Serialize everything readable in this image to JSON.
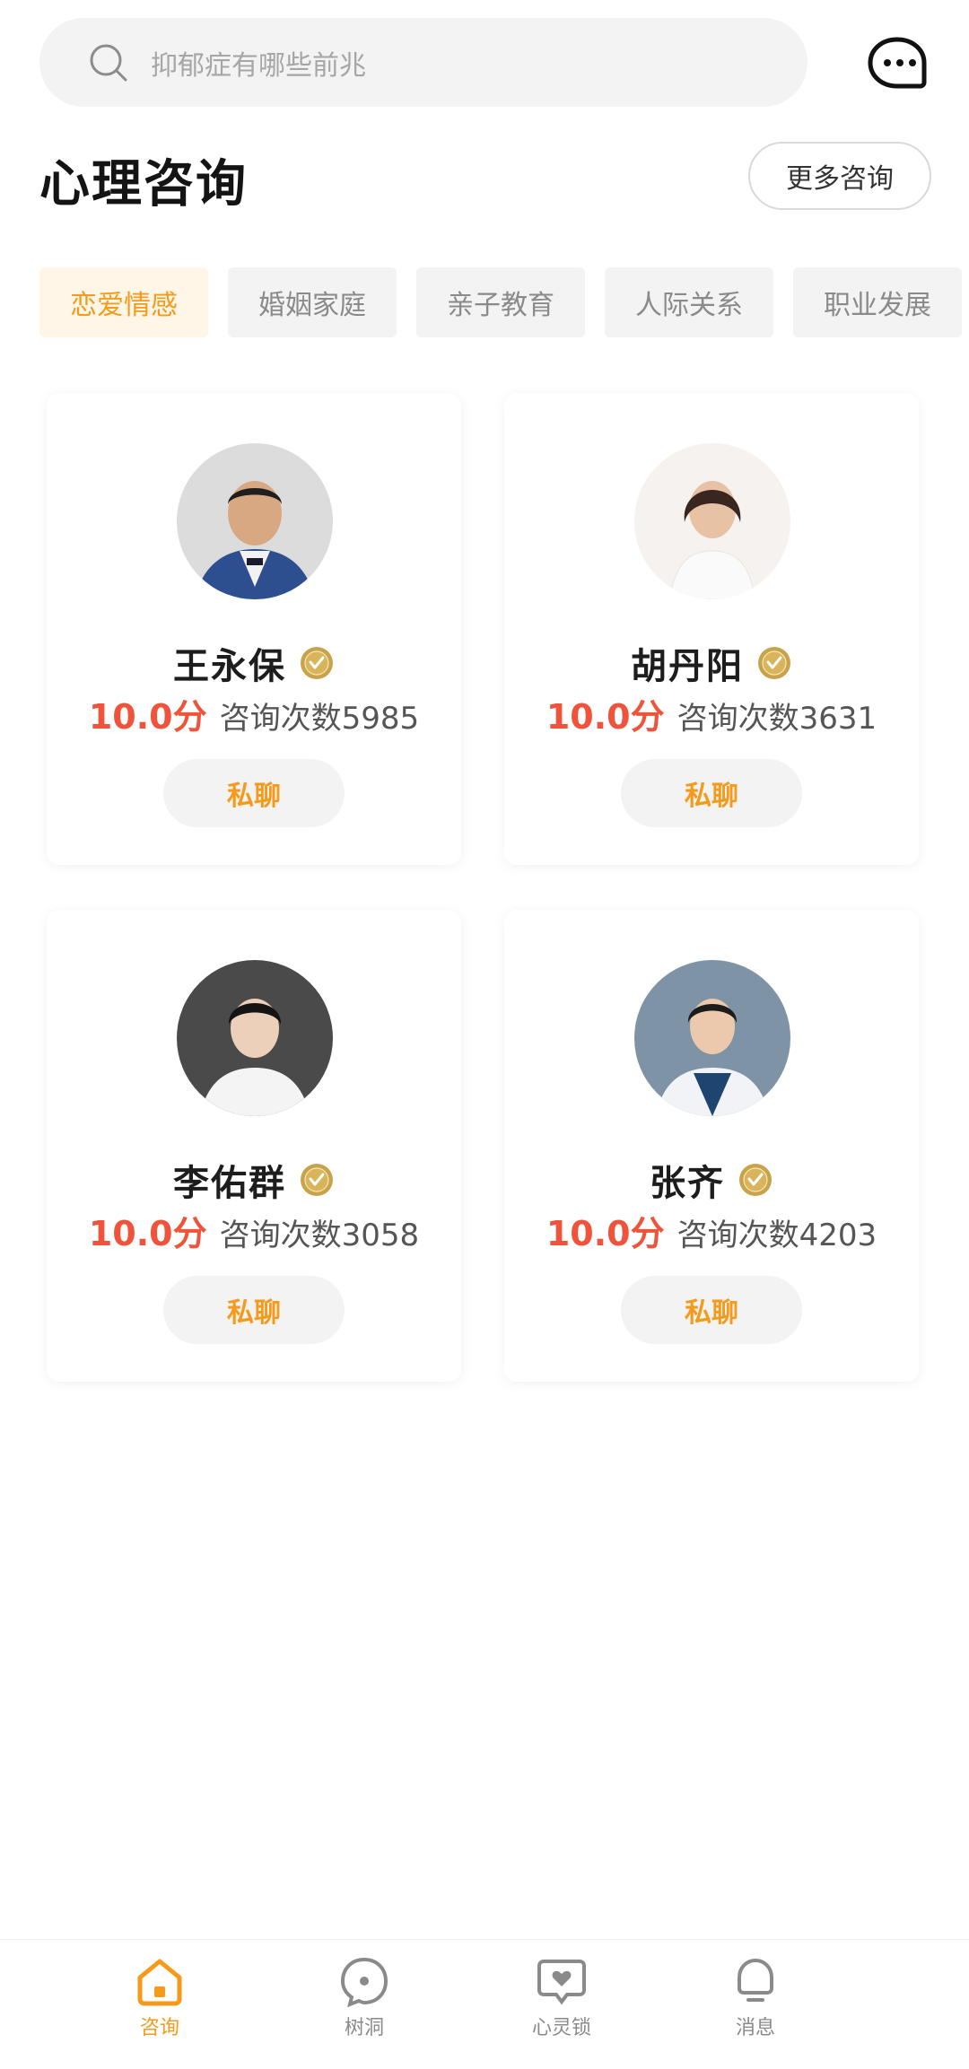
{
  "search": {
    "placeholder": "抑郁症有哪些前兆"
  },
  "header": {
    "title": "心理咨询",
    "more_label": "更多咨询"
  },
  "tabs": [
    {
      "label": "恋爱情感",
      "active": true
    },
    {
      "label": "婚姻家庭",
      "active": false
    },
    {
      "label": "亲子教育",
      "active": false
    },
    {
      "label": "人际关系",
      "active": false
    },
    {
      "label": "职业发展",
      "active": false
    }
  ],
  "consultants": [
    {
      "name": "王永保",
      "score": "10.0分",
      "count": "咨询次数5985",
      "button": "私聊"
    },
    {
      "name": "胡丹阳",
      "score": "10.0分",
      "count": "咨询次数3631",
      "button": "私聊"
    },
    {
      "name": "李佑群",
      "score": "10.0分",
      "count": "咨询次数3058",
      "button": "私聊"
    },
    {
      "name": "张齐",
      "score": "10.0分",
      "count": "咨询次数4203",
      "button": "私聊"
    }
  ],
  "bottom_nav": [
    {
      "label": "咨询",
      "icon": "home-icon",
      "active": true
    },
    {
      "label": "树洞",
      "icon": "tree-hole-icon",
      "active": false
    },
    {
      "label": "心灵锁",
      "icon": "heart-lock-icon",
      "active": false
    },
    {
      "label": "消息",
      "icon": "bell-icon",
      "active": false
    }
  ],
  "colors": {
    "accent": "#f59a1a",
    "score": "#f0533c",
    "tab_active_bg": "#fff6e8",
    "chip_bg": "#f3f3f3"
  }
}
